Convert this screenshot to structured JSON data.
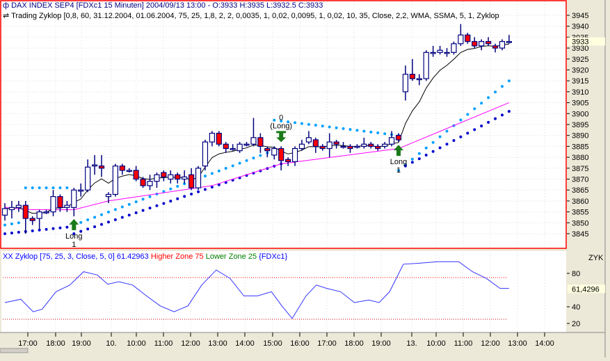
{
  "header": {
    "symbol_line": "DAX INDEX SEP4   [FDXc1  15 Minuten] 2004/09/13 13:00 - O:3933 H:3935 L:3932.5 C:3933",
    "indicator_line": "Trading Zyklop [0,8, 60, 31.12.2004, 01.06.2004, 75, 25, 1,8, 2, 2, 0,0035, 1, 0,02, 0,0095, 1, 0,02, 10, 35, Close, 2,2, WMA, SSMA, 5, 1, Zyklop"
  },
  "lower_header": {
    "name": "XX Zyklop [75, 25, 3, Close, 5, 0] 61.42963",
    "higher": "Higher Zone 75",
    "lower": "Lower Zone 25",
    "symbol": "{FDXc1}"
  },
  "colors": {
    "border": "#ff0000",
    "candle_outline": "#00007f",
    "down_fill": "#ff0000",
    "ma": "#000000",
    "pink": "#ff00ff",
    "dot_light": "#00a0ff",
    "dot_dark": "#0000cc",
    "signal": "#1a7a1a",
    "osc": "#3333ff"
  },
  "chart_data": [
    {
      "type": "candlestick",
      "title": "DAX INDEX SEP4",
      "ylim": [
        3840,
        3948
      ],
      "y_ticks": [
        3945,
        3940,
        3935,
        3930,
        3925,
        3920,
        3915,
        3910,
        3905,
        3900,
        3895,
        3890,
        3885,
        3880,
        3875,
        3870,
        3865,
        3860,
        3855,
        3850,
        3845
      ],
      "last_price_label": "3933",
      "ohlc": [
        [
          3853.5,
          3859,
          3851,
          3856.5
        ],
        [
          3856,
          3860,
          3852,
          3857
        ],
        [
          3857,
          3860,
          3855,
          3858
        ],
        [
          3858,
          3860,
          3845,
          3852
        ],
        [
          3852,
          3853,
          3849,
          3851
        ],
        [
          3852,
          3856,
          3847,
          3855
        ],
        [
          3855,
          3856,
          3854,
          3855
        ],
        [
          3855,
          3865,
          3853,
          3862
        ],
        [
          3862,
          3863,
          3855,
          3857
        ],
        [
          3857,
          3860,
          3855,
          3858
        ],
        [
          3857,
          3866,
          3853,
          3865
        ],
        [
          3865,
          3868,
          3862,
          3865
        ],
        [
          3865,
          3879,
          3864,
          3875.5
        ],
        [
          3876.5,
          3881,
          3872,
          3876.5
        ],
        [
          3876,
          3881,
          3871,
          3875
        ],
        [
          3862,
          3864,
          3859,
          3863
        ],
        [
          3863,
          3877,
          3862,
          3876
        ],
        [
          3876,
          3877,
          3872,
          3874
        ],
        [
          3874,
          3875,
          3873,
          3874
        ],
        [
          3874,
          3876,
          3869,
          3870
        ],
        [
          3870,
          3871,
          3866,
          3867
        ],
        [
          3867,
          3872,
          3865,
          3869
        ],
        [
          3869,
          3873,
          3866,
          3872
        ],
        [
          3873,
          3874,
          3869,
          3871
        ],
        [
          3870,
          3874,
          3868,
          3872
        ],
        [
          3872,
          3873,
          3868,
          3870
        ],
        [
          3870,
          3874,
          3868,
          3871
        ],
        [
          3872,
          3875,
          3865,
          3866
        ],
        [
          3866,
          3876,
          3865,
          3875
        ],
        [
          3876,
          3888,
          3874,
          3887
        ],
        [
          3887,
          3892,
          3885,
          3891
        ],
        [
          3891,
          3892,
          3885,
          3886
        ],
        [
          3886,
          3887,
          3882,
          3884
        ],
        [
          3884,
          3886,
          3883,
          3884
        ],
        [
          3883,
          3887,
          3882,
          3886
        ],
        [
          3886,
          3887,
          3885,
          3886
        ],
        [
          3886,
          3898,
          3885,
          3889
        ],
        [
          3889,
          3891,
          3882,
          3885
        ],
        [
          3884,
          3885,
          3880,
          3883
        ],
        [
          3881,
          3885,
          3879,
          3884
        ],
        [
          3884,
          3885,
          3874,
          3878.5
        ],
        [
          3879,
          3880,
          3876,
          3878
        ],
        [
          3878,
          3885,
          3876,
          3884
        ],
        [
          3884,
          3888,
          3883,
          3886
        ],
        [
          3887,
          3892,
          3886,
          3889
        ],
        [
          3888,
          3889,
          3882,
          3885
        ],
        [
          3885,
          3886,
          3883,
          3884
        ],
        [
          3884,
          3891,
          3880,
          3887
        ],
        [
          3887,
          3888,
          3884,
          3886
        ],
        [
          3885,
          3887,
          3884,
          3885
        ],
        [
          3885,
          3886,
          3882,
          3884
        ],
        [
          3885,
          3886,
          3884,
          3885
        ],
        [
          3885,
          3889,
          3884,
          3886
        ],
        [
          3886,
          3887,
          3884,
          3885
        ],
        [
          3885,
          3886,
          3883,
          3884
        ],
        [
          3885,
          3887,
          3884,
          3886
        ],
        [
          3886,
          3892,
          3885,
          3889
        ],
        [
          3890,
          3891,
          3887,
          3888
        ],
        [
          3910,
          3922,
          3906,
          3918
        ],
        [
          3918,
          3925,
          3915,
          3916
        ],
        [
          3916,
          3918,
          3913,
          3916
        ],
        [
          3916,
          3929,
          3915,
          3928
        ],
        [
          3928,
          3931,
          3926,
          3928
        ],
        [
          3928,
          3931,
          3927,
          3929
        ],
        [
          3928,
          3930,
          3926,
          3928
        ],
        [
          3928,
          3933,
          3927,
          3932
        ],
        [
          3932,
          3941,
          3931,
          3936
        ],
        [
          3936,
          3937,
          3932,
          3933
        ],
        [
          3933,
          3935,
          3930,
          3931
        ],
        [
          3931,
          3934,
          3929,
          3933
        ],
        [
          3933,
          3935,
          3931,
          3932
        ],
        [
          3931,
          3932,
          3928,
          3930
        ],
        [
          3930,
          3934,
          3929,
          3933
        ],
        [
          3933,
          3936,
          3932,
          3933
        ]
      ],
      "pink_line": [
        [
          0,
          3857
        ],
        [
          4,
          3856
        ],
        [
          10,
          3856
        ],
        [
          15,
          3860
        ],
        [
          30,
          3867
        ],
        [
          40,
          3877
        ],
        [
          57,
          3884
        ],
        [
          73,
          3905
        ]
      ],
      "dots_light": [
        [
          0,
          3849,
          2,
          3850
        ],
        [
          3,
          3866,
          9,
          3866
        ],
        [
          10,
          3849,
          38,
          3882
        ],
        [
          39,
          3897,
          57,
          3890
        ],
        [
          57,
          3874,
          73,
          3915
        ]
      ],
      "dots_dark": [
        [
          0,
          3845,
          9,
          3848
        ],
        [
          10,
          3845,
          40,
          3877
        ],
        [
          58,
          3876,
          73,
          3901
        ]
      ],
      "signals": [
        {
          "idx": 10,
          "dir": "up",
          "label": "Long",
          "sub": "1"
        },
        {
          "idx": 40,
          "dir": "down",
          "label": "(Long)",
          "sub": "0"
        },
        {
          "idx": 57,
          "dir": "up",
          "label": "Long",
          "sub": "1"
        }
      ]
    },
    {
      "type": "line",
      "title": "Zyklop",
      "axis_label": "ZYK",
      "ylim": [
        10,
        100
      ],
      "y_ticks": [
        80,
        40,
        20
      ],
      "last_value_label": "61,4296",
      "higher_zone": 75,
      "lower_zone": 25,
      "points": [
        [
          0,
          45
        ],
        [
          2.3,
          49
        ],
        [
          4.1,
          34
        ],
        [
          5.4,
          37
        ],
        [
          7.4,
          58
        ],
        [
          9.4,
          66
        ],
        [
          11.4,
          82
        ],
        [
          13.4,
          78
        ],
        [
          14.9,
          67
        ],
        [
          16.5,
          70
        ],
        [
          18.5,
          66
        ],
        [
          20.5,
          53
        ],
        [
          22.5,
          41
        ],
        [
          24.5,
          34
        ],
        [
          26.5,
          41
        ],
        [
          28.5,
          66
        ],
        [
          30.6,
          84
        ],
        [
          32.6,
          74
        ],
        [
          34.6,
          53
        ],
        [
          36.6,
          53
        ],
        [
          38.6,
          58
        ],
        [
          40.1,
          41
        ],
        [
          41.6,
          26
        ],
        [
          43.6,
          53
        ],
        [
          45.1,
          66
        ],
        [
          46.6,
          62
        ],
        [
          48.6,
          58
        ],
        [
          50.6,
          45
        ],
        [
          52.7,
          48
        ],
        [
          54.2,
          45
        ],
        [
          55.7,
          58
        ],
        [
          57.7,
          91
        ],
        [
          59.7,
          92
        ],
        [
          62.7,
          94
        ],
        [
          65.7,
          94
        ],
        [
          67.7,
          82
        ],
        [
          69.7,
          74
        ],
        [
          71.7,
          62
        ],
        [
          73,
          62
        ]
      ]
    }
  ],
  "time_axis": [
    "17:00",
    "18:00",
    "19:00",
    "10.",
    "10:00",
    "11:00",
    "12:00",
    "13:00",
    "14:00",
    "15:00",
    "16:00",
    "17:00",
    "18:00",
    "19:00",
    "13.",
    "10:00",
    "11:00",
    "12:00",
    "13:00",
    "14:00"
  ]
}
